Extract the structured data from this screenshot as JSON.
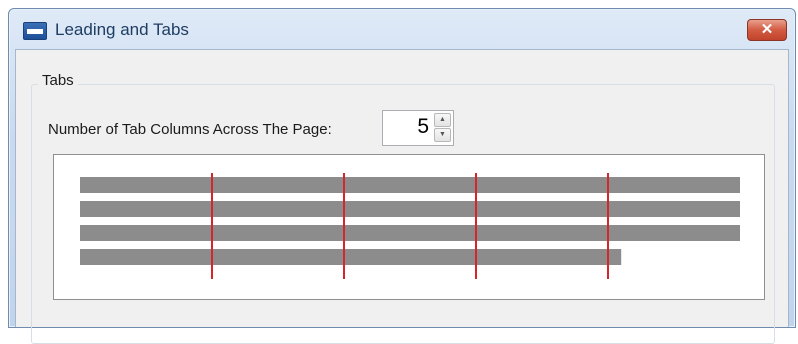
{
  "window": {
    "title": "Leading and Tabs",
    "icon": "app-document-icon",
    "close_label": "✕"
  },
  "tabs_group": {
    "label": "Tabs",
    "columns_label": "Number of Tab Columns Across The Page:",
    "columns_value": "5",
    "spinner_up": "▲",
    "spinner_down": "▼"
  },
  "preview": {
    "line_color": "#8c8c8c",
    "tab_marker_color": "#d6262b",
    "line_lengths": [
      1,
      1,
      1,
      0.82
    ]
  }
}
